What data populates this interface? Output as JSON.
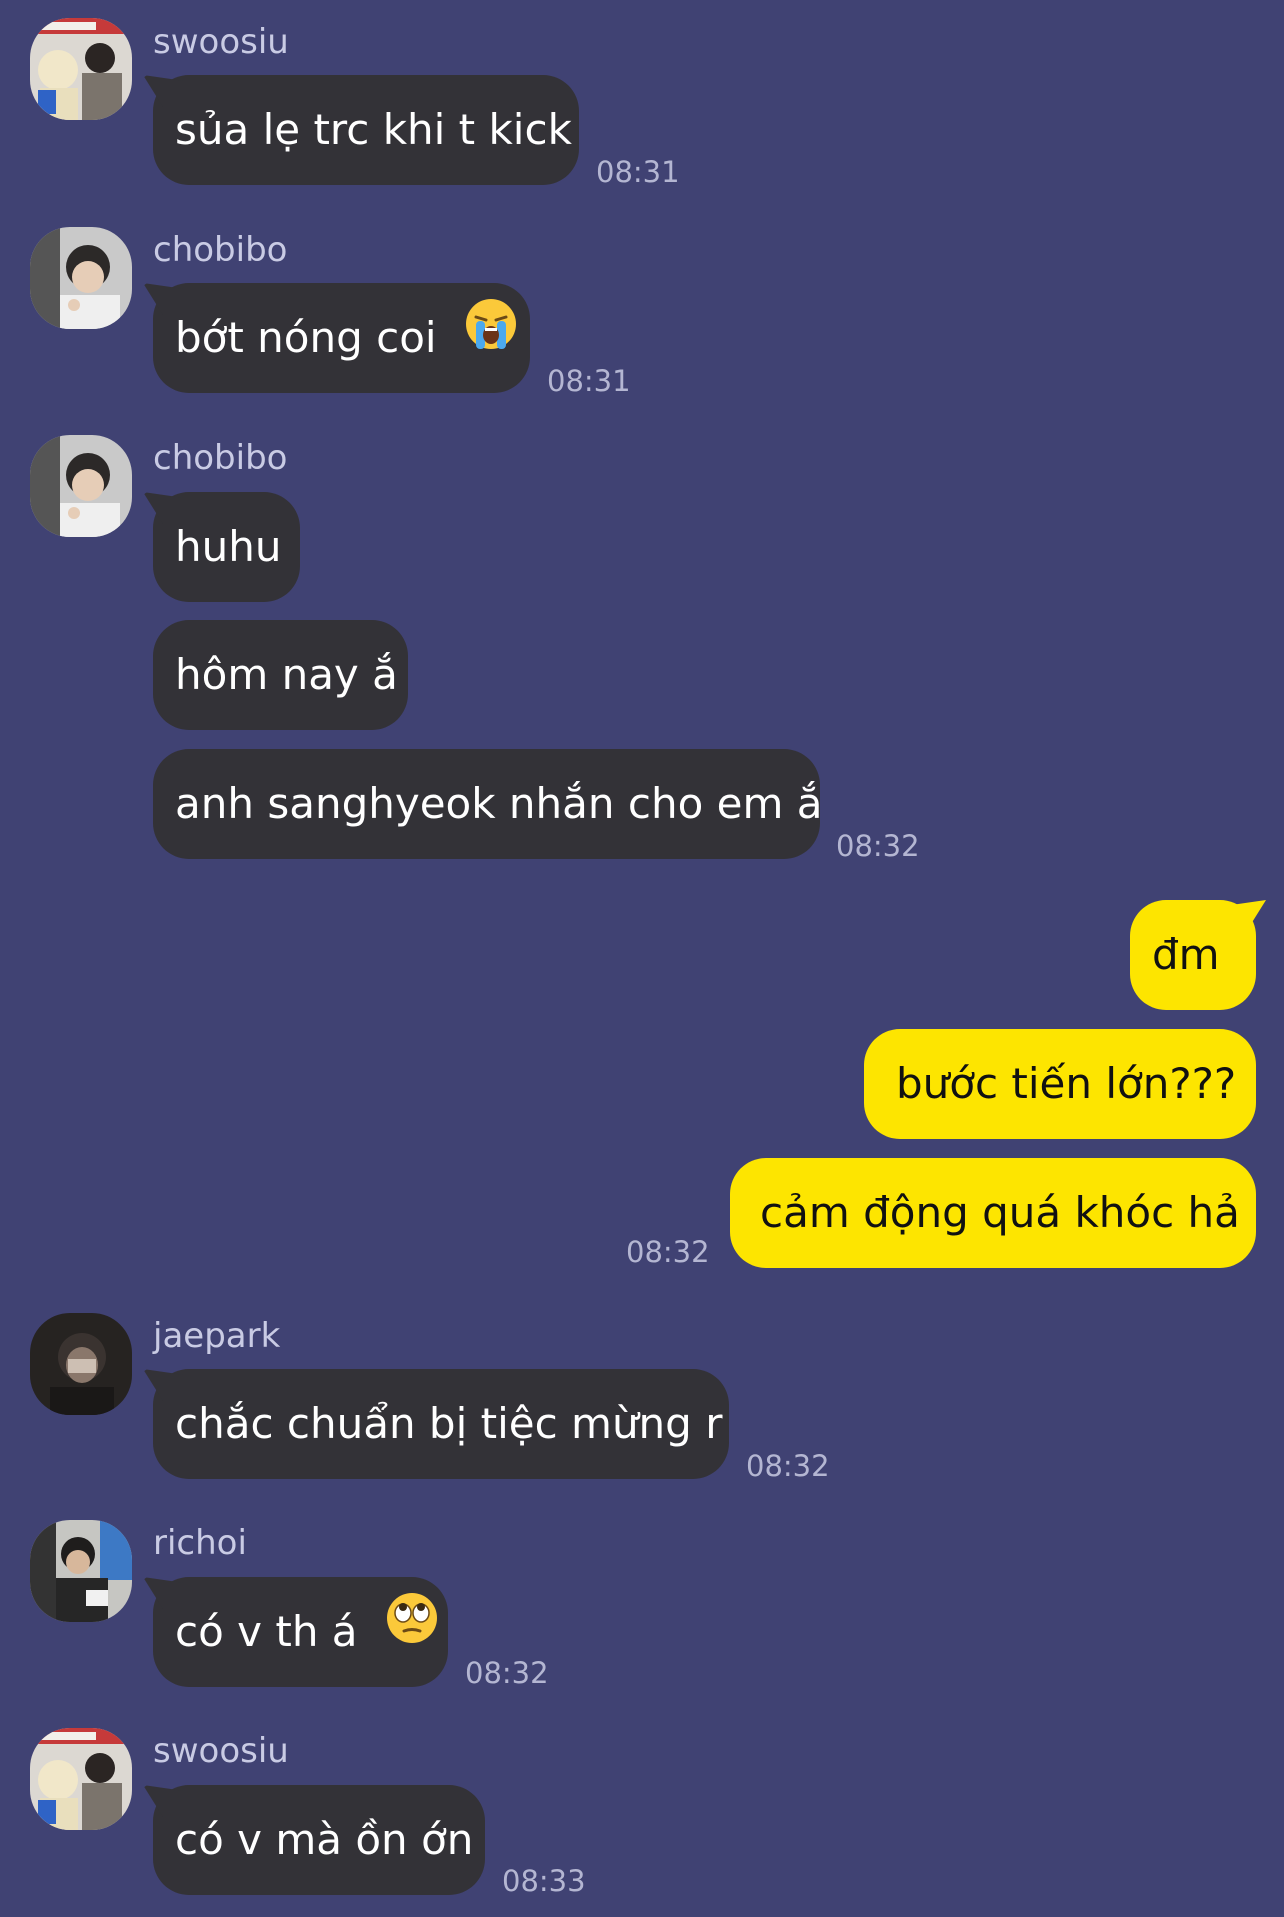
{
  "colors": {
    "background": "#404273",
    "incoming_bubble": "#333237",
    "outgoing_bubble": "#fde500",
    "sender_name": "#c9cbe4",
    "timestamp": "#b4b6d2"
  },
  "messages": [
    {
      "sender": "swoosiu",
      "text": "sủa lẹ trc khi t kick",
      "time": "08:31"
    },
    {
      "sender": "chobibo",
      "text": "bớt nóng coi",
      "emoji": "loudly-crying-face-icon",
      "time": "08:31"
    },
    {
      "sender": "chobibo",
      "texts": [
        "huhu",
        "hôm nay ắ",
        "anh sanghyeok nhắn cho em ắ"
      ],
      "time": "08:32"
    },
    {
      "sender": "me",
      "texts": [
        "đm",
        "bước tiến lớn???",
        "cảm động quá khóc hả"
      ],
      "time": "08:32"
    },
    {
      "sender": "jaepark",
      "text": "chắc chuẩn bị tiệc mừng r",
      "time": "08:32"
    },
    {
      "sender": "richoi",
      "text": "có v th á",
      "emoji": "face-with-rolling-eyes-icon",
      "time": "08:32"
    },
    {
      "sender": "swoosiu",
      "text": "có v mà ồn ớn",
      "time": "08:33"
    }
  ]
}
